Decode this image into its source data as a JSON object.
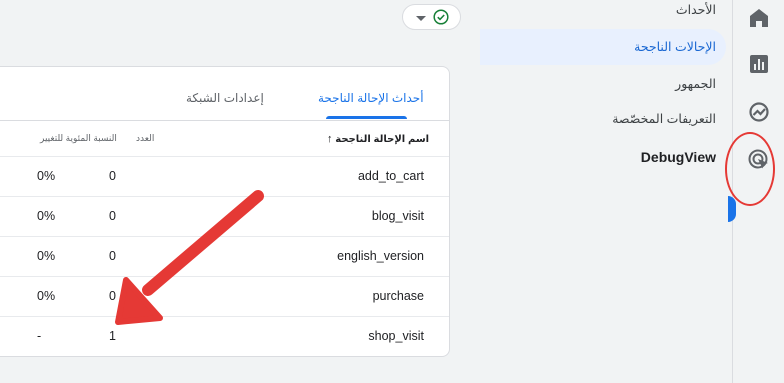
{
  "nav": {
    "items": [
      {
        "label": "الأحداث"
      },
      {
        "label": "الإحالات الناجحة"
      },
      {
        "label": "الجمهور"
      },
      {
        "label": "التعريفات المخصّصة"
      },
      {
        "label": "DebugView"
      }
    ]
  },
  "rail": {
    "icons": [
      "home-icon",
      "reports-icon",
      "explore-icon",
      "advertising-icon"
    ]
  },
  "pill": {
    "status_icon": "check-circle-icon",
    "dropdown_icon": "caret-down-icon"
  },
  "tabs": [
    {
      "label": "أحداث الإحالة الناجحة",
      "active": true
    },
    {
      "label": "إعدادات الشبكة",
      "active": false
    }
  ],
  "table": {
    "headers": {
      "name": "اسم الإحالة الناجحة",
      "count": "العدد",
      "pct": "النسبة المئوية للتغيير"
    },
    "rows": [
      {
        "name": "add_to_cart",
        "count": "0",
        "pct": "0%"
      },
      {
        "name": "blog_visit",
        "count": "0",
        "pct": "0%"
      },
      {
        "name": "english_version",
        "count": "0",
        "pct": "0%"
      },
      {
        "name": "purchase",
        "count": "0",
        "pct": "0%"
      },
      {
        "name": "shop_visit",
        "count": "1",
        "pct": "-"
      }
    ]
  },
  "colors": {
    "accent": "#1a73e8",
    "annotation": "#e53935",
    "selected_bg": "#e8f0fe"
  }
}
